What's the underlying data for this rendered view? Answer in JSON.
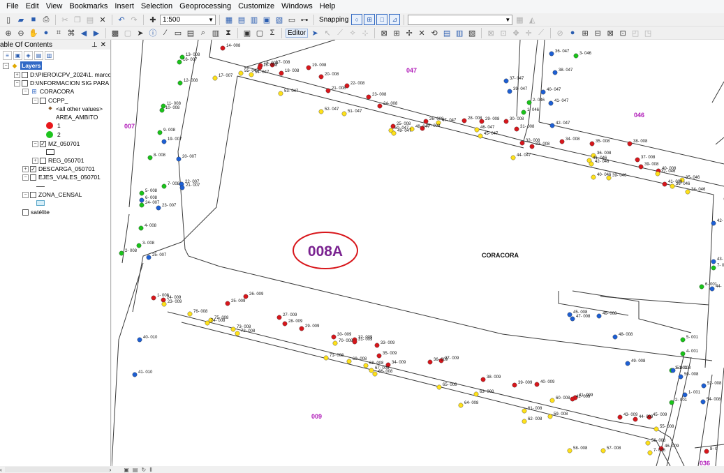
{
  "menu": [
    "File",
    "Edit",
    "View",
    "Bookmarks",
    "Insert",
    "Selection",
    "Geoprocessing",
    "Customize",
    "Windows",
    "Help"
  ],
  "toolbar": {
    "scale": "1:500",
    "snapping_label": "Snapping",
    "editor_label": "Editor"
  },
  "toc": {
    "title": "able Of Contents",
    "layers_root": "Layers",
    "items": [
      {
        "label": "D:\\PIERO\\CPV_2024\\1. marco -",
        "checked": false
      },
      {
        "label": "D:\\INFORMACION SIG PARA T",
        "checked": false
      },
      {
        "label": "CORACORA"
      },
      {
        "label": "CCPP_",
        "checked": false
      },
      {
        "label": "<all other values>"
      },
      {
        "label": "AREA_AMBITO"
      },
      {
        "label": "1",
        "color": "#e8171b"
      },
      {
        "label": "2",
        "color": "#1ec41e"
      },
      {
        "label": "MZ_050701",
        "checked": true
      },
      {
        "label": "REG_050701",
        "checked": false
      },
      {
        "label": "DESCARGA_050701",
        "checked": true
      },
      {
        "label": "EJES_VIALES_050701",
        "checked": false
      },
      {
        "label": "ZONA_CENSAL",
        "checked": false
      },
      {
        "label": "satélite",
        "checked": false
      }
    ]
  },
  "map": {
    "block_label": "008A",
    "locality_label": "CORACORA",
    "area_labels": [
      {
        "text": "047",
        "color": "#b01ab8"
      },
      {
        "text": "046",
        "color": "#b01ab8"
      },
      {
        "text": "007",
        "color": "#b01ab8"
      },
      {
        "text": "009",
        "color": "#b01ab8"
      },
      {
        "text": "036",
        "color": "#b01ab8"
      }
    ],
    "colors": {
      "red": "#d8161b",
      "yellow": "#ffe11a",
      "green": "#19c419",
      "blue": "#1d5fd4",
      "ellipse": "#d8161b",
      "block_text": "#7a2390"
    },
    "points": [
      {
        "label": "14- 008",
        "c": "red"
      },
      {
        "label": "13- 008",
        "c": "green"
      },
      {
        "label": "16- 007",
        "c": "green"
      },
      {
        "label": "15- 008",
        "c": "red"
      },
      {
        "label": "16- 008",
        "c": "red"
      },
      {
        "label": "17- 008",
        "c": "red"
      },
      {
        "label": "19- 008",
        "c": "red"
      },
      {
        "label": "55- 047",
        "c": "yellow"
      },
      {
        "label": "54- 047",
        "c": "yellow"
      },
      {
        "label": "17- 007",
        "c": "yellow"
      },
      {
        "label": "18- 008",
        "c": "red"
      },
      {
        "label": "20- 008",
        "c": "red"
      },
      {
        "label": "12- 008",
        "c": "green"
      },
      {
        "label": "22- 008",
        "c": "red"
      },
      {
        "label": "53- 047",
        "c": "yellow"
      },
      {
        "label": "21- 008",
        "c": "red"
      },
      {
        "label": "23- 008",
        "c": "red"
      },
      {
        "label": "24- 008",
        "c": "red"
      },
      {
        "label": "52- 047",
        "c": "yellow"
      },
      {
        "label": "51- 047",
        "c": "yellow"
      },
      {
        "label": "11- 008",
        "c": "green"
      },
      {
        "label": "10- 008",
        "c": "green"
      },
      {
        "label": "9- 008",
        "c": "green"
      },
      {
        "label": "19- 007",
        "c": "blue"
      },
      {
        "label": "8- 008",
        "c": "green"
      },
      {
        "label": "20- 007",
        "c": "blue"
      },
      {
        "label": "7- 008",
        "c": "green"
      },
      {
        "label": "22- 007",
        "c": "blue"
      },
      {
        "label": "21- 007",
        "c": "blue"
      },
      {
        "label": "5- 008",
        "c": "green"
      },
      {
        "label": "6- 008",
        "c": "blue"
      },
      {
        "label": "24- 007",
        "c": "green"
      },
      {
        "label": "23- 007",
        "c": "blue"
      },
      {
        "label": "4- 008",
        "c": "green"
      },
      {
        "label": "3- 008",
        "c": "green"
      },
      {
        "label": "2- 008",
        "c": "green"
      },
      {
        "label": "25- 007",
        "c": "blue"
      },
      {
        "label": "26- 008",
        "c": "red"
      },
      {
        "label": "47- 047",
        "c": "yellow"
      },
      {
        "label": "25- 008",
        "c": "red"
      },
      {
        "label": "27- 008",
        "c": "red"
      },
      {
        "label": "50- 047",
        "c": "yellow"
      },
      {
        "label": "49- 047",
        "c": "yellow"
      },
      {
        "label": "48- 047",
        "c": "yellow"
      },
      {
        "label": "46- 047",
        "c": "yellow"
      },
      {
        "label": "45- 047",
        "c": "yellow"
      },
      {
        "label": "28- 008",
        "c": "red"
      },
      {
        "label": "29- 008",
        "c": "red"
      },
      {
        "label": "30- 008",
        "c": "red"
      },
      {
        "label": "31- 008",
        "c": "red"
      },
      {
        "label": "37- 047",
        "c": "blue"
      },
      {
        "label": "39- 047",
        "c": "blue"
      },
      {
        "label": "36- 047",
        "c": "blue"
      },
      {
        "label": "3- 046",
        "c": "green"
      },
      {
        "label": "38- 047",
        "c": "blue"
      },
      {
        "label": "40- 047",
        "c": "blue"
      },
      {
        "label": "2- 046",
        "c": "green"
      },
      {
        "label": "41- 047",
        "c": "blue"
      },
      {
        "label": "1- 046",
        "c": "green"
      },
      {
        "label": "42- 047",
        "c": "blue"
      },
      {
        "label": "44- 047",
        "c": "yellow"
      },
      {
        "label": "32- 008",
        "c": "red"
      },
      {
        "label": "33- 008",
        "c": "red"
      },
      {
        "label": "34- 008",
        "c": "red"
      },
      {
        "label": "35- 008",
        "c": "red"
      },
      {
        "label": "36- 008",
        "c": "yellow"
      },
      {
        "label": "41- 046",
        "c": "yellow"
      },
      {
        "label": "42- 046",
        "c": "yellow"
      },
      {
        "label": "40- 046",
        "c": "yellow"
      },
      {
        "label": "39- 046",
        "c": "yellow"
      },
      {
        "label": "38- 008",
        "c": "red"
      },
      {
        "label": "37- 008",
        "c": "red"
      },
      {
        "label": "39- 008",
        "c": "red"
      },
      {
        "label": "40- 008",
        "c": "red"
      },
      {
        "label": "37- 046",
        "c": "yellow"
      },
      {
        "label": "36- 046",
        "c": "yellow"
      },
      {
        "label": "41- 008",
        "c": "red"
      },
      {
        "label": "35- 046",
        "c": "yellow"
      },
      {
        "label": "34- 046",
        "c": "yellow"
      },
      {
        "label": "9- 0",
        "c": "red"
      },
      {
        "label": "42- 008",
        "c": "blue"
      },
      {
        "label": "43- 008",
        "c": "blue"
      },
      {
        "label": "7- 0",
        "c": "green"
      },
      {
        "label": "6- 001",
        "c": "green"
      },
      {
        "label": "44-",
        "c": "blue"
      },
      {
        "label": "1- 008",
        "c": "red"
      },
      {
        "label": "24- 009",
        "c": "red"
      },
      {
        "label": "23- 009",
        "c": "yellow"
      },
      {
        "label": "26- 009",
        "c": "red"
      },
      {
        "label": "25- 009",
        "c": "red"
      },
      {
        "label": "76- 008",
        "c": "yellow"
      },
      {
        "label": "75- 008",
        "c": "yellow"
      },
      {
        "label": "74- 008",
        "c": "yellow"
      },
      {
        "label": "73- 008",
        "c": "yellow"
      },
      {
        "label": "72- 008",
        "c": "yellow"
      },
      {
        "label": "27- 009",
        "c": "red"
      },
      {
        "label": "28- 009",
        "c": "red"
      },
      {
        "label": "29- 009",
        "c": "red"
      },
      {
        "label": "30- 009",
        "c": "red"
      },
      {
        "label": "32- 009",
        "c": "red"
      },
      {
        "label": "70- 008",
        "c": "yellow"
      },
      {
        "label": "31- 009",
        "c": "red"
      },
      {
        "label": "33- 009",
        "c": "red"
      },
      {
        "label": "35- 009",
        "c": "red"
      },
      {
        "label": "34- 009",
        "c": "red"
      },
      {
        "label": "71- 008",
        "c": "yellow"
      },
      {
        "label": "69- 008",
        "c": "yellow"
      },
      {
        "label": "68- 008",
        "c": "yellow"
      },
      {
        "label": "67- 008",
        "c": "yellow"
      },
      {
        "label": "66- 008",
        "c": "yellow"
      },
      {
        "label": "36- 009",
        "c": "red"
      },
      {
        "label": "37- 009",
        "c": "red"
      },
      {
        "label": "38- 009",
        "c": "red"
      },
      {
        "label": "39- 009",
        "c": "red"
      },
      {
        "label": "40- 009",
        "c": "red"
      },
      {
        "label": "65- 008",
        "c": "yellow"
      },
      {
        "label": "63- 008",
        "c": "yellow"
      },
      {
        "label": "64- 008",
        "c": "yellow"
      },
      {
        "label": "41- 009",
        "c": "red"
      },
      {
        "label": "42- 009",
        "c": "red"
      },
      {
        "label": "60- 008",
        "c": "yellow"
      },
      {
        "label": "61- 008",
        "c": "yellow"
      },
      {
        "label": "59- 008",
        "c": "yellow"
      },
      {
        "label": "62- 008",
        "c": "yellow"
      },
      {
        "label": "45- 008",
        "c": "blue"
      },
      {
        "label": "47- 008",
        "c": "blue"
      },
      {
        "label": "46- 008",
        "c": "blue"
      },
      {
        "label": "48- 008",
        "c": "blue"
      },
      {
        "label": "49- 008",
        "c": "blue"
      },
      {
        "label": "40- 010",
        "c": "blue"
      },
      {
        "label": "41- 010",
        "c": "blue"
      },
      {
        "label": "5- 001",
        "c": "green"
      },
      {
        "label": "4- 001",
        "c": "green"
      },
      {
        "label": "3- 001",
        "c": "green"
      },
      {
        "label": "51- 008",
        "c": "blue"
      },
      {
        "label": "50- 008",
        "c": "blue"
      },
      {
        "label": "52- 008",
        "c": "blue"
      },
      {
        "label": "1- 001",
        "c": "blue"
      },
      {
        "label": "54- 008",
        "c": "blue"
      },
      {
        "label": "2- 001",
        "c": "green"
      },
      {
        "label": "43- 009",
        "c": "red"
      },
      {
        "label": "44- 009",
        "c": "red"
      },
      {
        "label": "45- 009",
        "c": "red"
      },
      {
        "label": "55- 008",
        "c": "yellow"
      },
      {
        "label": "56- 008",
        "c": "yellow"
      },
      {
        "label": "46- 009",
        "c": "red"
      },
      {
        "label": "7- 036",
        "c": "yellow"
      },
      {
        "label": "58- 008",
        "c": "yellow"
      },
      {
        "label": "57- 008",
        "c": "yellow"
      },
      {
        "label": "8- 0",
        "c": "red"
      }
    ]
  }
}
